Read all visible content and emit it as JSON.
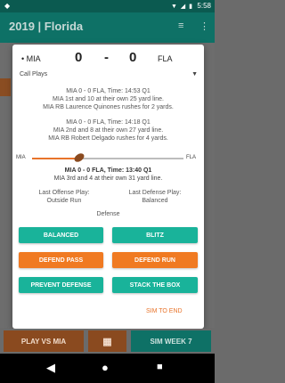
{
  "status_bar": {
    "time": "5:58",
    "notification_icon": "android-icon",
    "icons": "▼ ◢ ▮"
  },
  "app_bar": {
    "title": "2019 | Florida",
    "actions": [
      "≡",
      "⋮"
    ]
  },
  "dialog": {
    "scoreboard": {
      "away_team": "• MIA",
      "away_score": "0",
      "separator": "-",
      "home_score": "0",
      "home_team": "FLA"
    },
    "filter": {
      "selected": "Call Plays"
    },
    "play_log": [
      [
        "MIA 0 - 0 FLA, Time: 14:53 Q1",
        "MIA 1st and 10 at their own 25 yard line.",
        "MIA RB Laurence Quinones rushes for 2 yards."
      ],
      [
        "MIA 0 - 0 FLA, Time: 14:18 Q1",
        "MIA 2nd and 8 at their own 27 yard line.",
        "MIA RB Robert Delgado rushes for 4 yards."
      ]
    ],
    "field": {
      "left_end": "MIA",
      "right_end": "FLA",
      "ball_position_fraction": 0.31
    },
    "current_play": {
      "header": "MIA 0 - 0 FLA, Time: 13:40 Q1",
      "situation": "MIA 3rd and 4 at their own 31 yard line."
    },
    "last_offense": {
      "label": "Last Offense Play:",
      "value": "Outside Run"
    },
    "last_defense": {
      "label": "Last Defense Play:",
      "value": "Balanced"
    },
    "section_label": "Defense",
    "buttons": {
      "balanced": "BALANCED",
      "blitz": "BLITZ",
      "defend_pass": "DEFEND PASS",
      "defend_run": "DEFEND RUN",
      "prevent_defense": "PREVENT DEFENSE",
      "stack_the_box": "STACK THE BOX"
    },
    "sim_to_end": "SIM TO END"
  },
  "bottom_buttons": {
    "play": "PLAY VS MIA",
    "middle_icon": "▦",
    "sim_week": "SIM WEEK 7"
  },
  "nav_bar": {
    "back": "◀",
    "home": "●",
    "recents": "■"
  },
  "colors": {
    "teal": "#19b39a",
    "orange": "#f07a22",
    "app_bar": "#0e7166"
  }
}
